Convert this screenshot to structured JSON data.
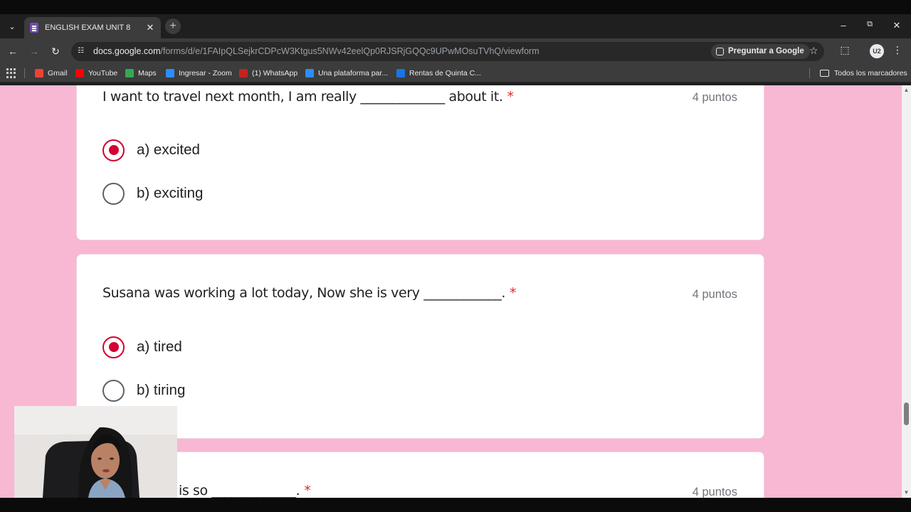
{
  "browser": {
    "tab_title": "ENGLISH EXAM UNIT 8",
    "url_host": "docs.google.com",
    "url_path": "/forms/d/e/1FAIpQLSejkrCDPcW3Ktgus5NWv42eelQp0RJSRjGQQc9UPwMOsuTVhQ/viewform",
    "ask_google_label": "Preguntar a Google",
    "profile_label": "U2",
    "bookmarks": [
      {
        "label": "Gmail",
        "color": "#ea4335"
      },
      {
        "label": "YouTube",
        "color": "#ff0000"
      },
      {
        "label": "Maps",
        "color": "#34a853"
      },
      {
        "label": "Ingresar - Zoom",
        "color": "#2d8cff"
      },
      {
        "label": "(1) WhatsApp",
        "color": "#c5221f"
      },
      {
        "label": "Una plataforma par...",
        "color": "#2d8cff"
      },
      {
        "label": "Rentas de Quinta C...",
        "color": "#1a73e8"
      }
    ],
    "all_bookmarks_label": "Todos los marcadores"
  },
  "form": {
    "accent_color": "#d50032",
    "background_color": "#f8b7d3",
    "questions": [
      {
        "title": "I want to travel next month, I am really _____________ about it.",
        "required_mark": "*",
        "points": "4 puntos",
        "options": [
          {
            "label": "a) excited",
            "selected": true
          },
          {
            "label": "b) exciting",
            "selected": false
          }
        ]
      },
      {
        "title": "Susana was working a lot today, Now she is very ____________.",
        "required_mark": "*",
        "points": "4 puntos",
        "options": [
          {
            "label": "a) tired",
            "selected": true
          },
          {
            "label": "b) tiring",
            "selected": false
          }
        ]
      },
      {
        "title": "is so _____________.",
        "required_mark": "*",
        "points": "4 puntos",
        "options": []
      }
    ]
  }
}
